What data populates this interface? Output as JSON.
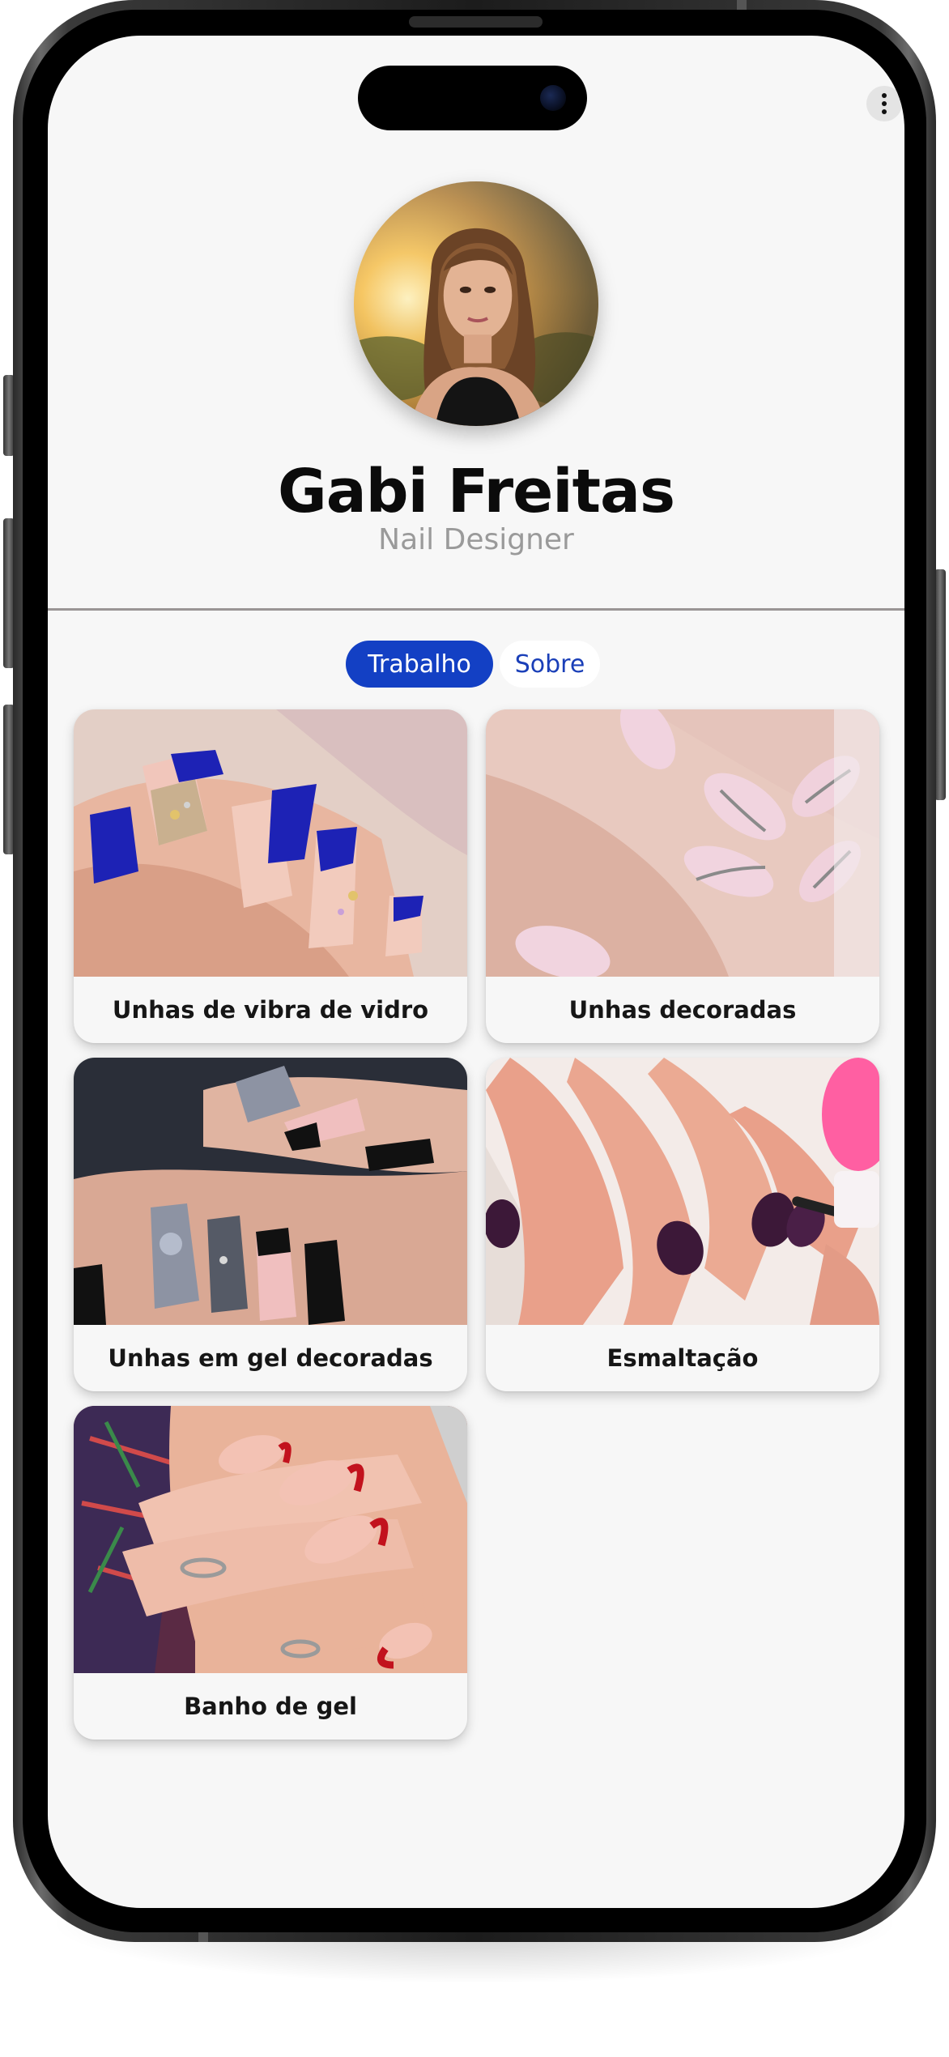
{
  "profile": {
    "name": "Gabi Freitas",
    "role": "Nail Designer",
    "avatar_icon": "profile-photo"
  },
  "tabs": [
    {
      "label": "Trabalho",
      "active": true
    },
    {
      "label": "Sobre",
      "active": false
    }
  ],
  "gallery": [
    {
      "label": "Unhas de vibra de vidro",
      "colors": [
        "#1d22b5",
        "#f2c9be",
        "#e8b9a6"
      ]
    },
    {
      "label": "Unhas decoradas",
      "colors": [
        "#f1d4df",
        "#e9c7cf",
        "#8a8a8a"
      ]
    },
    {
      "label": "Unhas em gel decoradas",
      "colors": [
        "#111111",
        "#f0bfbf",
        "#8d93a3"
      ]
    },
    {
      "label": "Esmaltação",
      "colors": [
        "#3c1838",
        "#e9a08a",
        "#ff5fa2"
      ]
    },
    {
      "label": "Banho de gel",
      "colors": [
        "#c2121d",
        "#f3c2b4",
        "#e9b39a"
      ]
    }
  ],
  "colors": {
    "accent": "#1340c4",
    "background": "#f7f7f7",
    "name_text": "#0b0b0b",
    "role_text": "#9a9a9a"
  },
  "menu_icon": "more-vertical-icon"
}
